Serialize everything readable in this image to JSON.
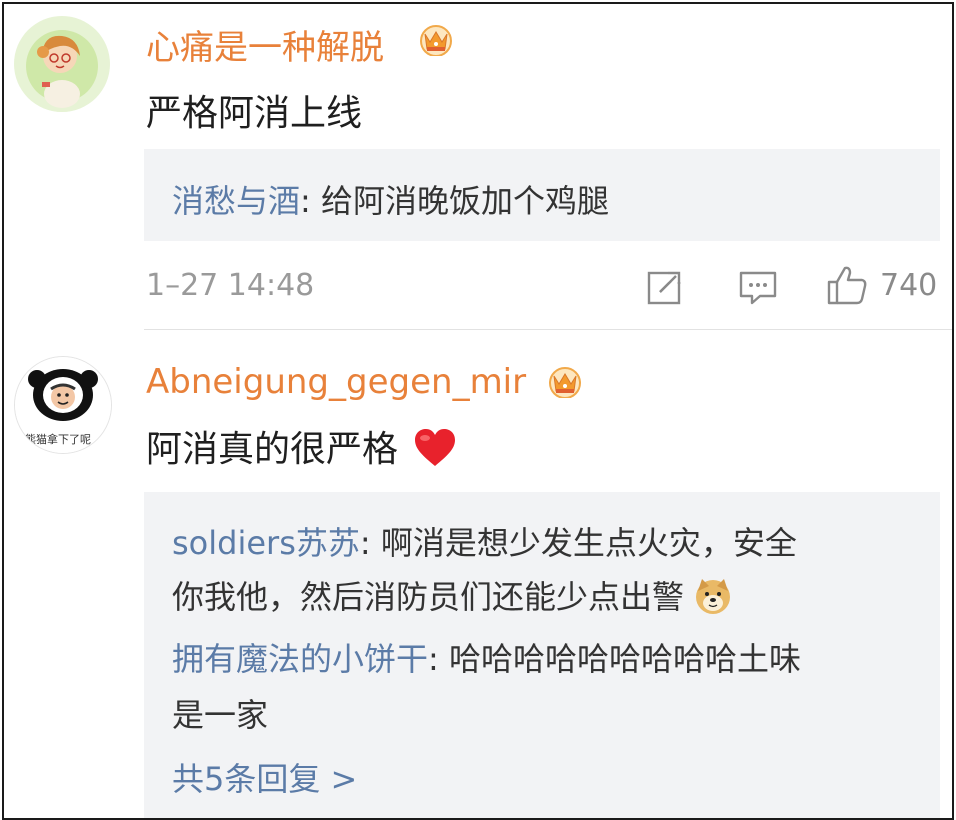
{
  "comments": [
    {
      "username": "心痛是一种解脱",
      "text": "严格阿消上线",
      "replies": [
        {
          "user": "消愁与酒",
          "sep": ": ",
          "text": "给阿消晚饭加个鸡腿"
        }
      ],
      "timestamp": "1–27 14:48",
      "likes": "740"
    },
    {
      "username": "Abneigung_gegen_mir",
      "text": "阿消真的很严格",
      "replies": [
        {
          "user": "soldiers苏苏",
          "sep": ": ",
          "text1": "啊消是想少发生点火灾，安全",
          "text2": "你我他，然后消防员们还能少点出警"
        },
        {
          "user": "拥有魔法的小饼干",
          "sep": ": ",
          "text1": "哈哈哈哈哈哈哈哈哈土味",
          "text2": "是一家"
        }
      ],
      "more_replies": "共5条回复 >"
    }
  ],
  "avatar2_caption": "熊猫拿下了呢",
  "colors": {
    "username": "#e8813a",
    "reply_user": "#5b7ba7",
    "reply_bg": "#f2f3f5",
    "timestamp": "#9a9a9a"
  },
  "icons": [
    "vip-crown-icon",
    "share-icon",
    "comment-icon",
    "like-icon",
    "heart-emoji-icon",
    "doge-emoji-icon"
  ]
}
